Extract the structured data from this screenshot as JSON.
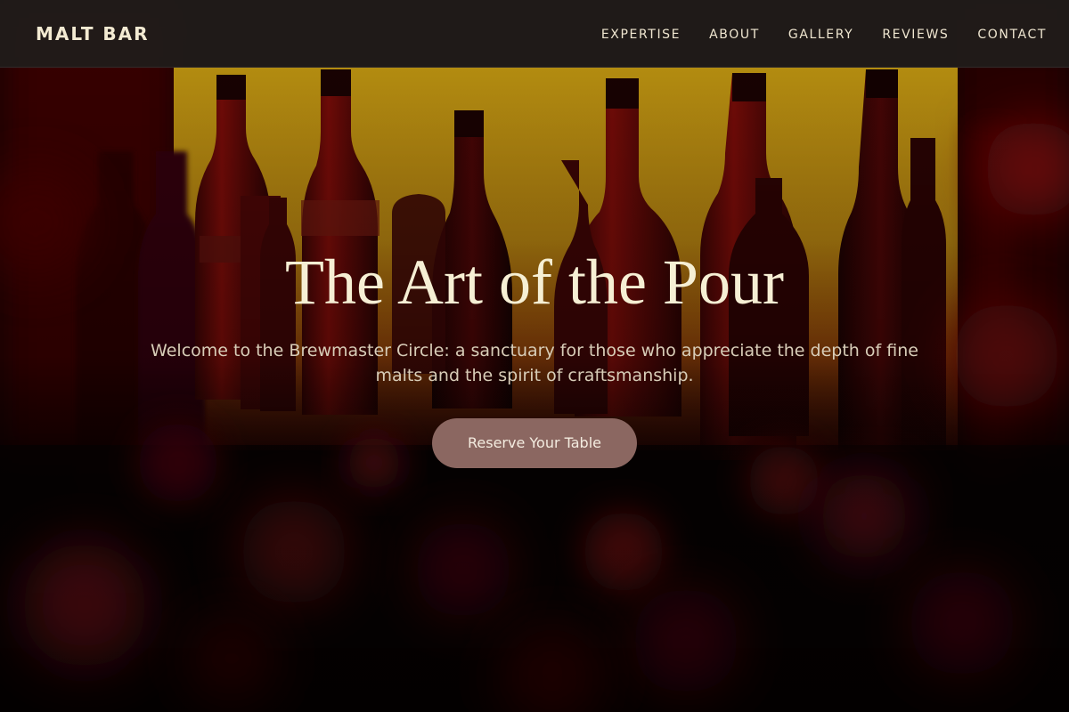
{
  "navbar": {
    "brand": "MALT BAR",
    "links": [
      {
        "label": "EXPERTISE"
      },
      {
        "label": "ABOUT"
      },
      {
        "label": "GALLERY"
      },
      {
        "label": "REVIEWS"
      },
      {
        "label": "CONTACT"
      }
    ]
  },
  "hero": {
    "title": "The Art of the Pour",
    "subtitle": "Welcome to the Brewmaster Circle: a sanctuary for those who appreciate the depth of fine malts and the spirit of craftsmanship.",
    "cta_label": "Reserve Your Table"
  },
  "colors": {
    "navbar_bg": "#201c1a",
    "brand_text": "#f3ead2",
    "title_text": "#f6efd4",
    "cta_bg": "#8b6761",
    "backlight": "#d9a814",
    "deep_red": "#5a0508"
  }
}
